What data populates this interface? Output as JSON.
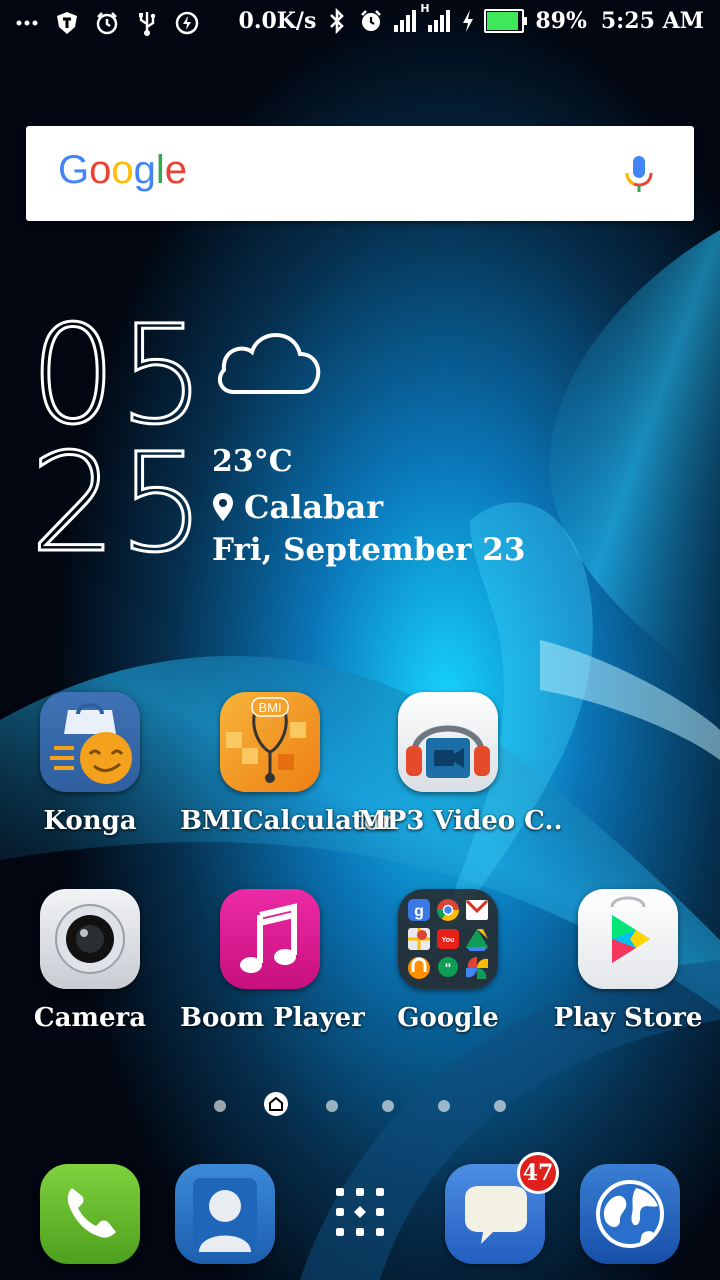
{
  "status_bar": {
    "left_icons": [
      "more-dots-icon",
      "shield-icon",
      "alarm-clock-icon",
      "usb-icon",
      "flash-icon"
    ],
    "net_speed": "0.0K/s",
    "right_icons": [
      "bluetooth-icon",
      "alarm-icon",
      "signal-icon",
      "signal-h-icon",
      "charging-icon"
    ],
    "battery_percent_label": "89%",
    "battery_level": 0.89,
    "time": "5:25 AM",
    "network_type": "H"
  },
  "search": {
    "logo_letters": [
      "G",
      "o",
      "o",
      "g",
      "l",
      "e"
    ],
    "logo_colors": [
      "#4285F4",
      "#EA4335",
      "#FBBC05",
      "#4285F4",
      "#34A853",
      "#EA4335"
    ]
  },
  "clock": {
    "hour": "05",
    "minute": "25"
  },
  "weather": {
    "icon": "cloud-icon",
    "temperature": "23°C",
    "location": "Calabar",
    "date": "Fri, September 23"
  },
  "apps_row1": [
    {
      "label": "Konga",
      "icon": "konga-icon"
    },
    {
      "label": "BMICalculator",
      "icon": "bmi-calculator-icon",
      "badge_text": "BMI"
    },
    {
      "label": "MP3 Video C..",
      "icon": "mp3-video-converter-icon"
    }
  ],
  "apps_row2": [
    {
      "label": "Camera",
      "icon": "camera-icon"
    },
    {
      "label": "Boom Player",
      "icon": "boom-player-icon"
    },
    {
      "label": "Google",
      "icon": "google-folder-icon"
    },
    {
      "label": "Play Store",
      "icon": "play-store-icon"
    }
  ],
  "google_folder_icons": [
    "google-icon",
    "chrome-icon",
    "gmail-icon",
    "maps-icon",
    "youtube-icon",
    "drive-icon",
    "music-icon",
    "hangouts-icon",
    "photos-icon"
  ],
  "google_folder_letters": {
    "google": "g",
    "youtube": "You",
    "hangouts": "\""
  },
  "page_indicator": {
    "count": 6,
    "active_index": 1,
    "active_icon": "home-icon"
  },
  "dock": [
    {
      "name": "phone-icon"
    },
    {
      "name": "contacts-icon"
    },
    {
      "name": "app-drawer-icon"
    },
    {
      "name": "messages-icon",
      "badge": "47"
    },
    {
      "name": "browser-icon"
    }
  ],
  "colors": {
    "konga_blue": "#2f5f9e",
    "konga_orange": "#f4a11d",
    "bmi_orange": "#f3961e",
    "boom_pink": "#e0158f",
    "phone_green": "#5cb82a",
    "contacts_blue": "#2a75c9",
    "messages_blue": "#2d6fd0",
    "browser_blue": "#1f5fbf",
    "badge_red": "#e0201c"
  }
}
